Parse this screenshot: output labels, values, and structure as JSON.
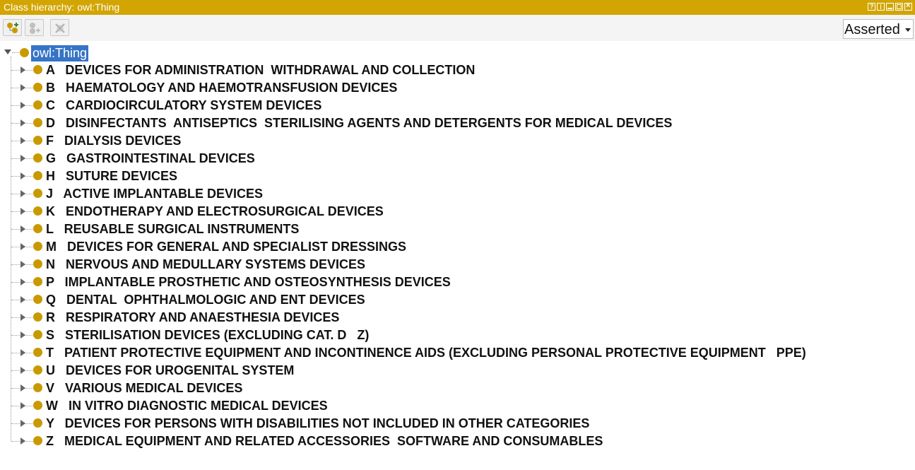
{
  "window": {
    "title": "Class hierarchy: owl:Thing"
  },
  "toolbar": {
    "buttons": [
      {
        "icon": "add-subclass-icon"
      },
      {
        "icon": "add-sibling-class-icon"
      },
      {
        "icon": "delete-class-icon"
      }
    ],
    "view_select": "Asserted"
  },
  "colors": {
    "titlebar": "#d2a502",
    "class_dot": "#c89a00",
    "selection": "#3674c6"
  },
  "tree": {
    "root_label": "owl:Thing",
    "items": [
      "A   DEVICES FOR ADMINISTRATION  WITHDRAWAL AND COLLECTION",
      "B   HAEMATOLOGY AND HAEMOTRANSFUSION DEVICES",
      "C   CARDIOCIRCULATORY SYSTEM DEVICES",
      "D   DISINFECTANTS  ANTISEPTICS  STERILISING AGENTS AND DETERGENTS FOR MEDICAL DEVICES",
      "F   DIALYSIS DEVICES",
      "G   GASTROINTESTINAL DEVICES",
      "H   SUTURE DEVICES",
      "J   ACTIVE IMPLANTABLE DEVICES",
      "K   ENDOTHERAPY AND ELECTROSURGICAL DEVICES",
      "L   REUSABLE SURGICAL INSTRUMENTS",
      "M   DEVICES FOR GENERAL AND SPECIALIST DRESSINGS",
      "N   NERVOUS AND MEDULLARY SYSTEMS DEVICES",
      "P   IMPLANTABLE PROSTHETIC AND OSTEOSYNTHESIS DEVICES",
      "Q   DENTAL  OPHTHALMOLOGIC AND ENT DEVICES",
      "R   RESPIRATORY AND ANAESTHESIA DEVICES",
      "S   STERILISATION DEVICES (EXCLUDING CAT. D   Z)",
      "T   PATIENT PROTECTIVE EQUIPMENT AND INCONTINENCE AIDS (EXCLUDING PERSONAL PROTECTIVE EQUIPMENT   PPE)",
      "U   DEVICES FOR UROGENITAL SYSTEM",
      "V   VARIOUS MEDICAL DEVICES",
      "W   IN VITRO DIAGNOSTIC MEDICAL DEVICES",
      "Y   DEVICES FOR PERSONS WITH DISABILITIES NOT INCLUDED IN OTHER CATEGORIES",
      "Z   MEDICAL EQUIPMENT AND RELATED ACCESSORIES  SOFTWARE AND CONSUMABLES"
    ]
  }
}
